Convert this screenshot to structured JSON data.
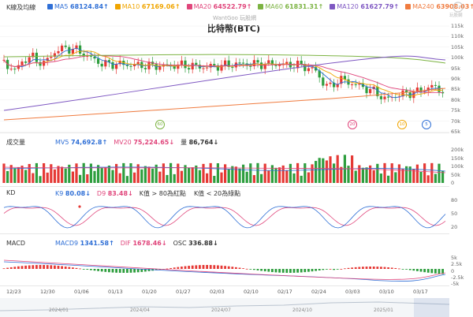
{
  "watermark": "WantGoo 玩股網",
  "title": "比特幣(BTC)",
  "logo_text": "玩股網",
  "price_panel": {
    "label": "K線及均線",
    "legend": [
      {
        "label": "MA5",
        "value": "68124.84↑",
        "color": "#2f6fd6"
      },
      {
        "label": "MA10",
        "value": "67169.06↑",
        "color": "#f0a500"
      },
      {
        "label": "MA20",
        "value": "64522.79↑",
        "color": "#e0457b"
      },
      {
        "label": "MA60",
        "value": "61831.31↑",
        "color": "#7cb342"
      },
      {
        "label": "MA120",
        "value": "61627.79↑",
        "color": "#7e57c2"
      },
      {
        "label": "MA240",
        "value": "63908.03↑",
        "color": "#f07b3f"
      }
    ],
    "y_ticks": [
      "115k",
      "110k",
      "105k",
      "100k",
      "95k",
      "90k",
      "85k",
      "80k",
      "75k",
      "70k",
      "65k"
    ],
    "markers": [
      {
        "text": "60",
        "color": "#7cb342"
      },
      {
        "text": "20",
        "color": "#e0457b"
      },
      {
        "text": "10",
        "color": "#f0a500"
      },
      {
        "text": "5",
        "color": "#2f6fd6"
      }
    ]
  },
  "volume_panel": {
    "label": "成交量",
    "legend": [
      {
        "label": "MV5",
        "value": "74,692.8↑",
        "color": "#2f6fd6"
      },
      {
        "label": "MV20",
        "value": "75,224.65↓",
        "color": "#e0457b"
      },
      {
        "label": "量",
        "value": "86,764↓",
        "color": "#333333"
      }
    ],
    "y_ticks": [
      "200k",
      "150k",
      "100k",
      "50k",
      "0"
    ]
  },
  "kd_panel": {
    "label": "KD",
    "legend": [
      {
        "label": "K9",
        "value": "80.08↓",
        "color": "#2f6fd6"
      },
      {
        "label": "D9",
        "value": "83.48↓",
        "color": "#e0457b"
      }
    ],
    "notes": [
      "K值 > 80為紅點",
      "K值 < 20為綠點"
    ],
    "y_ticks": [
      "80",
      "50",
      "20"
    ]
  },
  "macd_panel": {
    "label": "MACD",
    "legend": [
      {
        "label": "MACD9",
        "value": "1341.58↑",
        "color": "#2f6fd6"
      },
      {
        "label": "DIF",
        "value": "1678.46↓",
        "color": "#e0457b"
      },
      {
        "label": "OSC",
        "value": "336.88↓",
        "color": "#333333"
      }
    ],
    "y_ticks": [
      "5k",
      "2.5k",
      "0",
      "-2.5k",
      "-5k"
    ]
  },
  "x_axis": [
    "12/23",
    "12/30",
    "01/06",
    "01/13",
    "01/20",
    "01/27",
    "02/03",
    "02/10",
    "02/17",
    "02/24",
    "03/03",
    "03/10",
    "03/17"
  ],
  "timeline": [
    "2024/01",
    "2024/04",
    "2024/07",
    "2024/10",
    "2025/01"
  ],
  "colors": {
    "up": "#e53935",
    "down": "#2e9e3e",
    "grid": "#eeeeee"
  }
}
